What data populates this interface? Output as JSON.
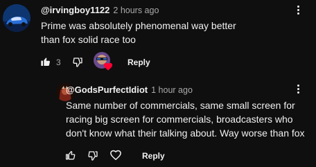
{
  "comments": [
    {
      "handle": "@irvingboy1122",
      "time": "2 hours ago",
      "text": "Prime was absolutely phenomenal way better than fox solid race too",
      "like_count": "3",
      "reply_label": "Reply"
    },
    {
      "handle": "@GodsPurfectIdiot",
      "time": "1 hour ago",
      "text": "Same number of commercials, same small screen for racing big screen for commercials, broadcasters who don't know what their talking about. Way worse than fox",
      "reply_label": "Reply"
    }
  ],
  "icons": {
    "like": "thumbs-up-icon",
    "dislike": "thumbs-down-icon",
    "heart": "heart-icon",
    "more": "more-vert-icon"
  },
  "colors": {
    "background": "#0f0f0f",
    "text": "#f1f1f1",
    "secondary": "#aaaaaa",
    "heart": "#ff0033"
  }
}
